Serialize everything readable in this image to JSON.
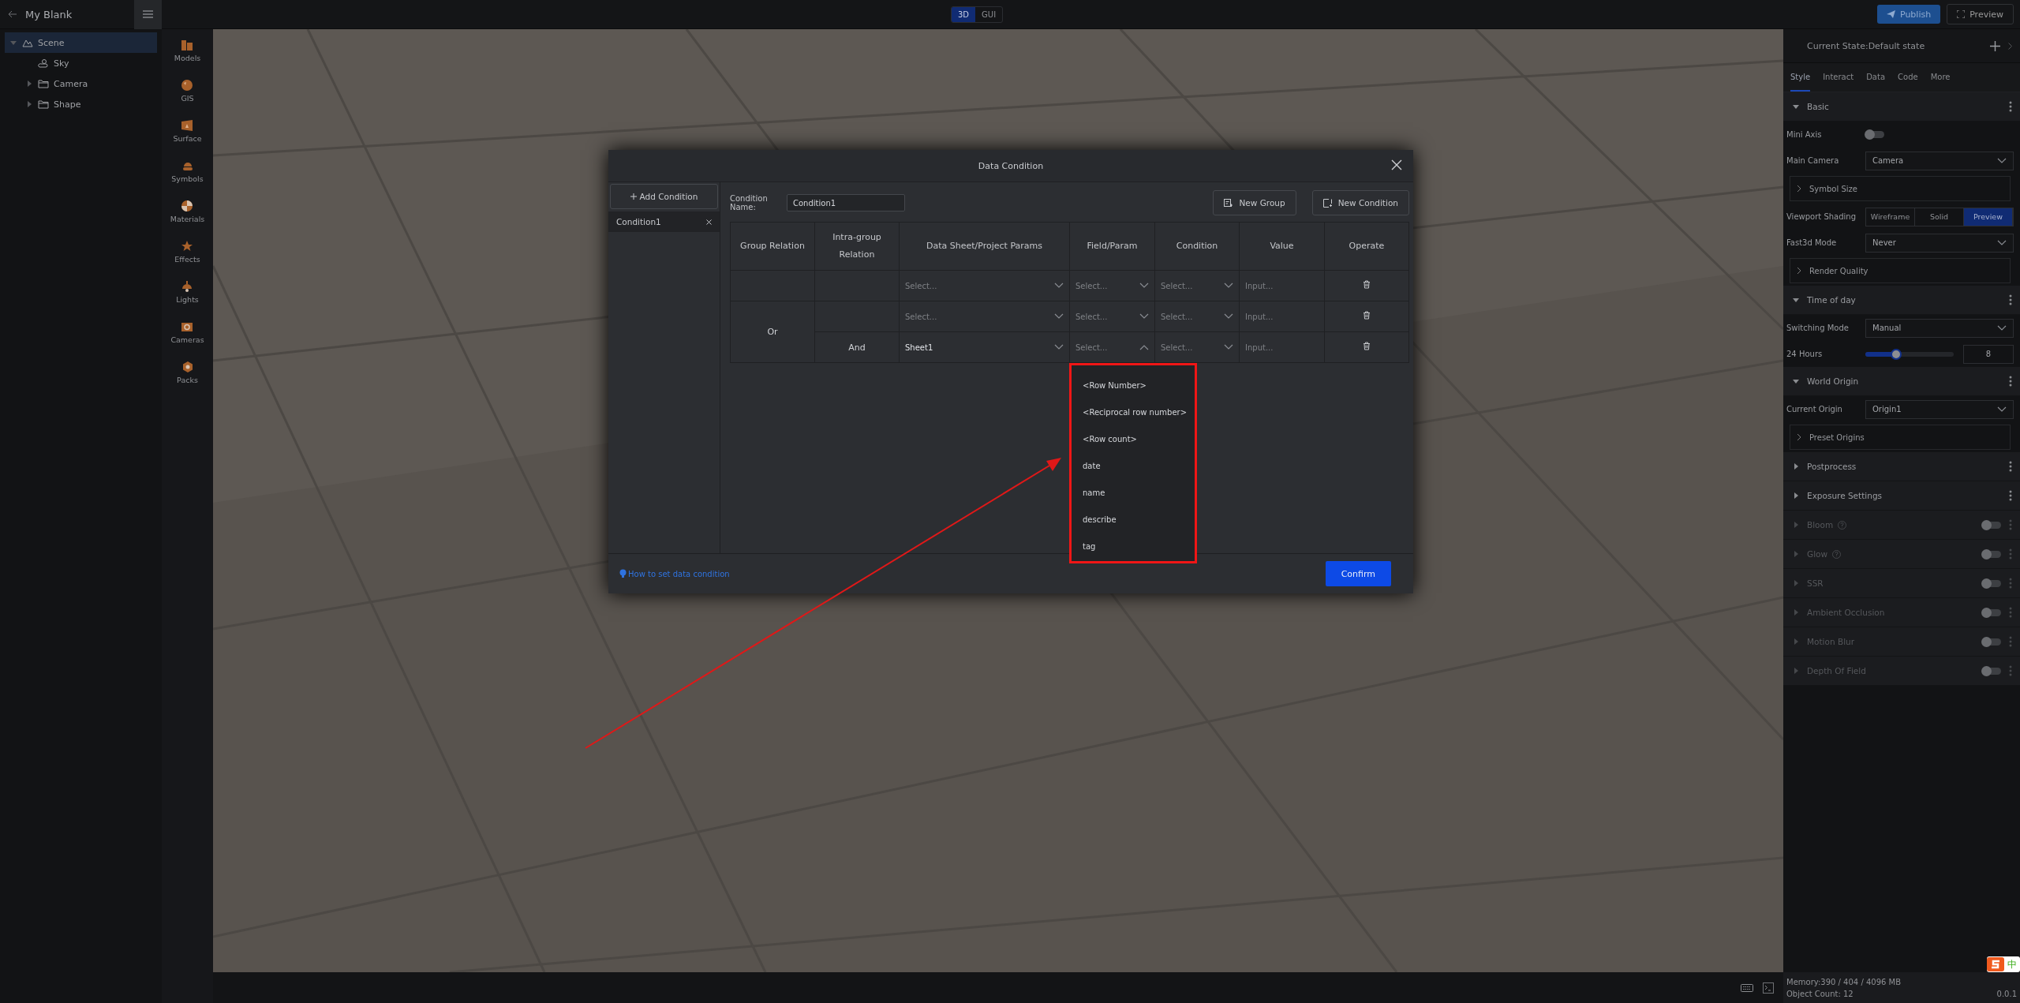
{
  "app": {
    "title": "My Blank"
  },
  "tree": [
    {
      "label": "Scene",
      "kind": "scene",
      "expanded": true,
      "selected": true,
      "children": [
        {
          "label": "Sky",
          "kind": "sky",
          "selected": false
        },
        {
          "label": "Camera",
          "kind": "folder",
          "expanded": false,
          "selected": false
        },
        {
          "label": "Shape",
          "kind": "folder",
          "expanded": false,
          "selected": false
        }
      ]
    }
  ],
  "palette": [
    {
      "label": "Models",
      "kind": "models"
    },
    {
      "label": "GIS",
      "kind": "globe"
    },
    {
      "label": "Surface",
      "kind": "surface"
    },
    {
      "label": "Symbols",
      "kind": "symbols"
    },
    {
      "label": "Materials",
      "kind": "materials"
    },
    {
      "label": "Effects",
      "kind": "effects"
    },
    {
      "label": "Lights",
      "kind": "lights"
    },
    {
      "label": "Cameras",
      "kind": "cameras"
    },
    {
      "label": "Packs",
      "kind": "packs"
    }
  ],
  "mode_toggle": [
    {
      "label": "3D",
      "selected": true
    },
    {
      "label": "GUI",
      "selected": false
    }
  ],
  "header_buttons": [
    {
      "label": "Publish",
      "kind": "primary"
    },
    {
      "label": "Preview",
      "kind": "outline"
    }
  ],
  "right_panel": {
    "state_title": "Current State:Default state",
    "tabs": [
      {
        "label": "Style",
        "selected": true
      },
      {
        "label": "Interact",
        "selected": false
      },
      {
        "label": "Data",
        "selected": false
      },
      {
        "label": "Code",
        "selected": false
      },
      {
        "label": "More",
        "selected": false
      }
    ],
    "sections": [
      {
        "title": "Basic",
        "expanded": true,
        "disabled": false,
        "help": false,
        "rows": [
          {
            "kind": "switch",
            "label": "Mini Axis",
            "on": false
          },
          {
            "kind": "select",
            "label": "Main Camera",
            "value": "Camera"
          },
          {
            "kind": "group",
            "label": "Symbol Size"
          },
          {
            "kind": "segmented",
            "label": "Viewport Shading",
            "options": [
              {
                "label": "Wireframe",
                "selected": false
              },
              {
                "label": "Solid",
                "selected": false
              },
              {
                "label": "Preview",
                "selected": true
              }
            ]
          },
          {
            "kind": "select",
            "label": "Fast3d Mode",
            "value": "Never"
          },
          {
            "kind": "group",
            "label": "Render Quality"
          }
        ]
      },
      {
        "title": "Time of day",
        "expanded": true,
        "disabled": false,
        "help": false,
        "rows": [
          {
            "kind": "select",
            "label": "Switching Mode",
            "value": "Manual"
          },
          {
            "kind": "slider",
            "label": "24 Hours",
            "level": 0.35,
            "value": "8"
          }
        ]
      },
      {
        "title": "World Origin",
        "expanded": true,
        "disabled": false,
        "help": false,
        "rows": [
          {
            "kind": "select",
            "label": "Current Origin",
            "value": "Origin1"
          },
          {
            "kind": "group",
            "label": "Preset Origins"
          }
        ]
      },
      {
        "title": "Postprocess",
        "expanded": false,
        "disabled": false,
        "help": false
      },
      {
        "title": "Exposure Settings",
        "expanded": false,
        "disabled": false,
        "help": false
      },
      {
        "title": "Bloom",
        "expanded": false,
        "disabled": true,
        "help": true,
        "on": false
      },
      {
        "title": "Glow",
        "expanded": false,
        "disabled": true,
        "help": true,
        "on": false
      },
      {
        "title": "SSR",
        "expanded": false,
        "disabled": true,
        "help": false,
        "on": false
      },
      {
        "title": "Ambient Occlusion",
        "expanded": false,
        "disabled": true,
        "help": false,
        "on": false
      },
      {
        "title": "Motion Blur",
        "expanded": false,
        "disabled": true,
        "help": false,
        "on": false
      },
      {
        "title": "Depth Of Field",
        "expanded": false,
        "disabled": true,
        "help": false,
        "on": false
      }
    ]
  },
  "status": {
    "memory": "Memory:390 / 404 / 4096 MB",
    "object_count": "Object Count: 12",
    "version": "0.0.1",
    "ime": "中"
  },
  "dialog": {
    "title": "Data Condition",
    "add_button": "Add Condition",
    "conditions": [
      {
        "label": "Condition1",
        "selected": true
      }
    ],
    "name_label": "Condition Name:",
    "name_value": "Condition1",
    "buttons": [
      {
        "label": "New Group",
        "kind": "group"
      },
      {
        "label": "New Condition",
        "kind": "condition"
      }
    ],
    "columns": [
      "Group Relation",
      "Intra-group Relation",
      "Data Sheet/Project Params",
      "Field/Param",
      "Condition",
      "Value",
      "Operate"
    ],
    "groups": [
      {
        "conditions": [
          {
            "sheet": {
              "placeholder": "Select..."
            },
            "field": {
              "placeholder": "Select...",
              "open": false
            },
            "condition": {
              "placeholder": "Select..."
            },
            "value": {
              "placeholder": "Input..."
            }
          }
        ]
      },
      {
        "relation": "Or",
        "conditions": [
          {
            "sheet": {
              "placeholder": "Select..."
            },
            "field": {
              "placeholder": "Select...",
              "open": false
            },
            "condition": {
              "placeholder": "Select..."
            },
            "value": {
              "placeholder": "Input..."
            }
          },
          {
            "intra_relation": "And",
            "sheet": {
              "value": "Sheet1"
            },
            "field": {
              "placeholder": "Select...",
              "open": true
            },
            "condition": {
              "placeholder": "Select..."
            },
            "value": {
              "placeholder": "Input..."
            }
          }
        ]
      }
    ],
    "dropdown_options": [
      "<Row Number>",
      "<Reciprocal row number>",
      "<Row count>",
      "date",
      "name",
      "describe",
      "tag"
    ],
    "help_link": "How to set data condition",
    "confirm": "Confirm"
  }
}
